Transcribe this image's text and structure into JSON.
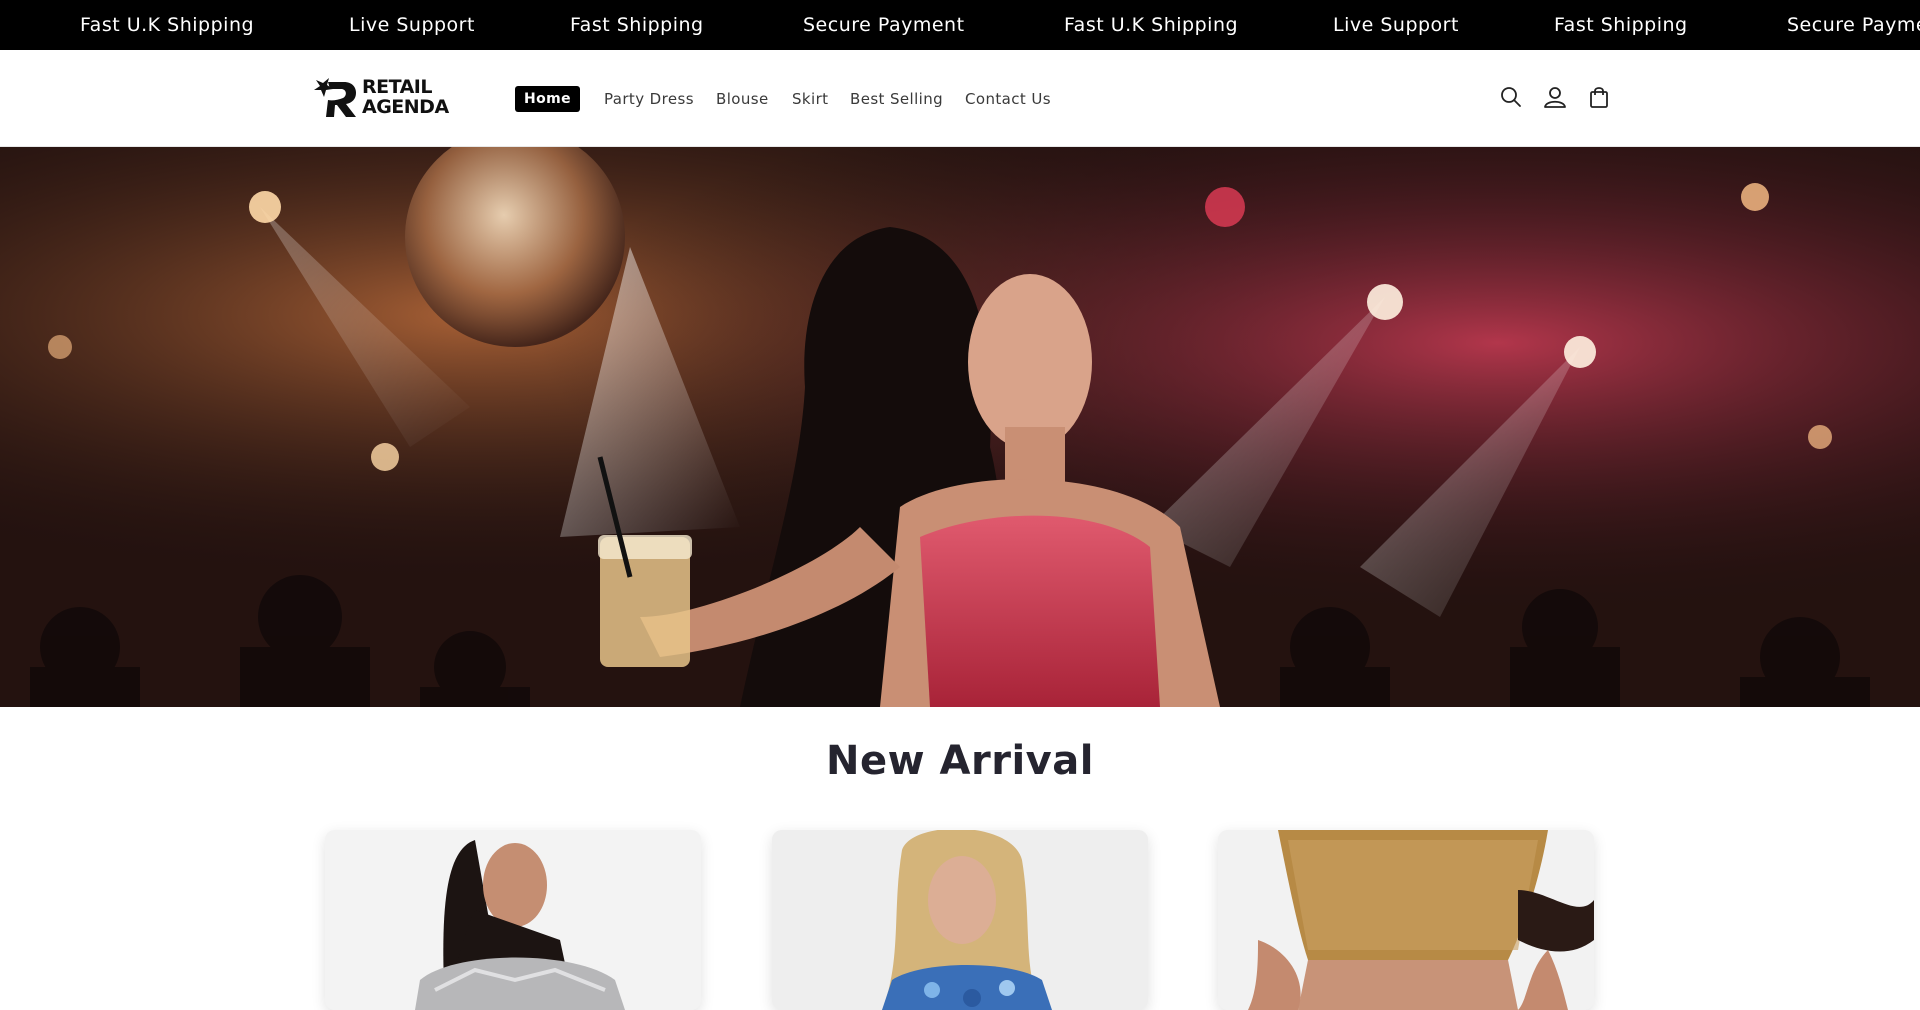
{
  "announcement": {
    "items": [
      "Fast U.K Shipping",
      "Live Support",
      "Fast Shipping",
      "Secure Payment",
      "Fast U.K Shipping",
      "Live Support",
      "Fast Shipping",
      "Secure Payment"
    ]
  },
  "header": {
    "logo": {
      "line1": "RETAIL",
      "line2": "AGENDA"
    },
    "nav": [
      "Home",
      "Party Dress",
      "Blouse",
      "Skirt",
      "Best Selling",
      "Contact Us"
    ],
    "icons": [
      "search-icon",
      "account-icon",
      "cart-icon"
    ]
  },
  "hero": {
    "image": "woman-in-sequin-dress-at-party"
  },
  "new_arrival": {
    "title": "New Arrival",
    "products": [
      {
        "image": "silver-sequin-top"
      },
      {
        "image": "blue-sequin-top"
      },
      {
        "image": "gold-chainmail-crop-top"
      }
    ]
  },
  "colors": {
    "bar": "#000000",
    "title": "#25242f",
    "accent": "#c7344a"
  }
}
